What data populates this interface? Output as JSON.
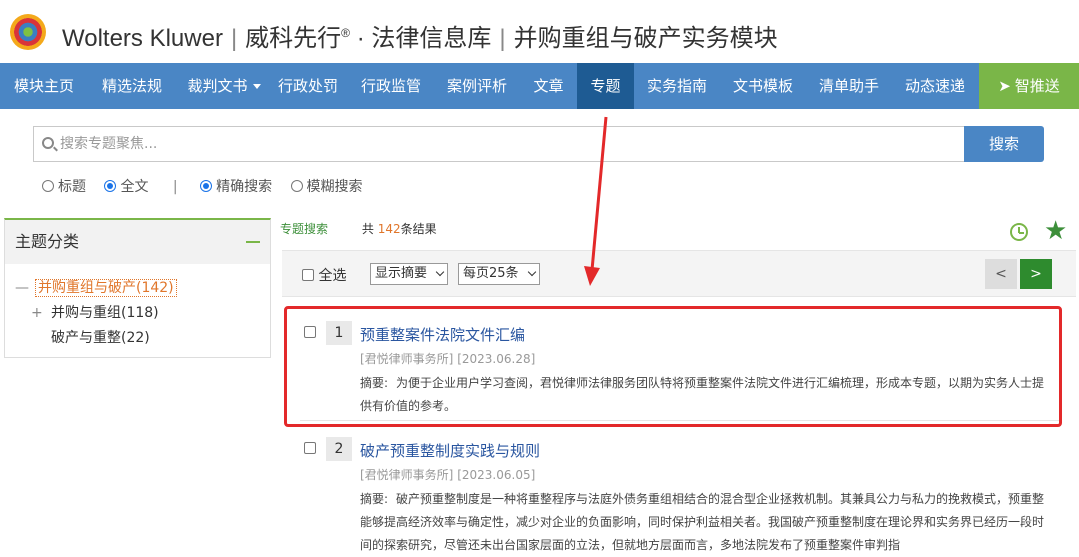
{
  "header": {
    "brand_en": "Wolters Kluwer",
    "brand_cn": "威科先行",
    "reg": "®",
    "dot": "·",
    "product": "法律信息库",
    "module": "并购重组与破产实务模块"
  },
  "nav": {
    "items": [
      "模块主页",
      "精选法规",
      "裁判文书",
      "行政处罚",
      "行政监管",
      "案例评析",
      "文章",
      "专题",
      "实务指南",
      "文书模板",
      "清单助手",
      "动态速递"
    ],
    "push": "智推送"
  },
  "search": {
    "placeholder": "搜索专题聚焦...",
    "button": "搜索",
    "opt_title": "标题",
    "opt_full": "全文",
    "divider": "|",
    "opt_exact": "精确搜索",
    "opt_fuzzy": "模糊搜索"
  },
  "sidebar": {
    "title": "主题分类",
    "top": "并购重组与破产(142)",
    "sub1": "并购与重组(118)",
    "sub2": "破产与重整(22)"
  },
  "results": {
    "tab": "专题搜索",
    "prefix": "共",
    "count": "142",
    "suffix": "条结果",
    "select_all": "全选",
    "view_mode": "显示摘要",
    "page_size": "每页25条",
    "prev": "<",
    "next": ">",
    "items": [
      {
        "num": "1",
        "title": "预重整案件法院文件汇编",
        "source": "[君悦律师事务所]",
        "date": "[2023.06.28]",
        "abstract_label": "摘要:",
        "abstract": "为便于企业用户学习查阅，君悦律师法律服务团队特将预重整案件法院文件进行汇编梳理，形成本专题，以期为实务人士提供有价值的参考。"
      },
      {
        "num": "2",
        "title": "破产预重整制度实践与规则",
        "source": "[君悦律师事务所]",
        "date": "[2023.06.05]",
        "abstract_label": "摘要:",
        "abstract": "破产预重整制度是一种将重整程序与法庭外债务重组相结合的混合型企业拯救机制。其兼具公力与私力的挽救模式，预重整能够提高经济效率与确定性，减少对企业的负面影响，同时保护利益相关者。我国破产预重整制度在理论界和实务界已经历一段时间的探索研究，尽管还未出台国家层面的立法，但就地方层面而言，多地法院发布了预重整案件审判指"
      }
    ]
  },
  "colors": {
    "nav_bg": "#4a86c5",
    "nav_active": "#1e5b93",
    "push_green": "#7ab648",
    "accent_orange": "#e0762b",
    "annotation_red": "#e3292a"
  }
}
